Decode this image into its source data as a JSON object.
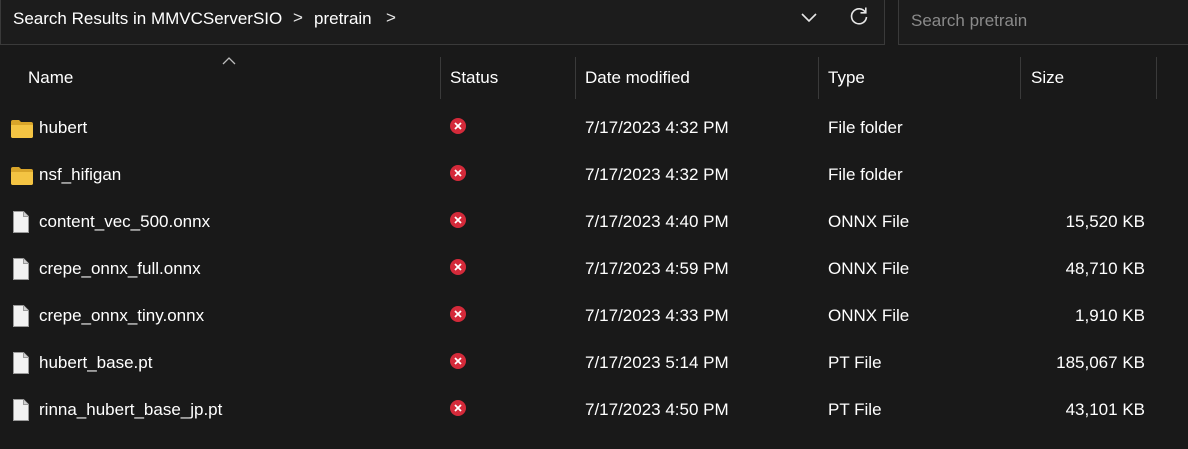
{
  "breadcrumb": {
    "items": [
      "Search Results in MMVCServerSIO",
      "pretrain"
    ],
    "separator": ">"
  },
  "search": {
    "placeholder": "Search pretrain",
    "value": ""
  },
  "columns": {
    "name": "Name",
    "status": "Status",
    "date": "Date modified",
    "type": "Type",
    "size": "Size"
  },
  "rows": [
    {
      "name": "hubert",
      "icon": "folder-icon",
      "status": "error-icon",
      "date": "7/17/2023 4:32 PM",
      "type": "File folder",
      "size": ""
    },
    {
      "name": "nsf_hifigan",
      "icon": "folder-icon",
      "status": "error-icon",
      "date": "7/17/2023 4:32 PM",
      "type": "File folder",
      "size": ""
    },
    {
      "name": "content_vec_500.onnx",
      "icon": "file-icon",
      "status": "error-icon",
      "date": "7/17/2023 4:40 PM",
      "type": "ONNX File",
      "size": "15,520 KB"
    },
    {
      "name": "crepe_onnx_full.onnx",
      "icon": "file-icon",
      "status": "error-icon",
      "date": "7/17/2023 4:59 PM",
      "type": "ONNX File",
      "size": "48,710 KB"
    },
    {
      "name": "crepe_onnx_tiny.onnx",
      "icon": "file-icon",
      "status": "error-icon",
      "date": "7/17/2023 4:33 PM",
      "type": "ONNX File",
      "size": "1,910 KB"
    },
    {
      "name": "hubert_base.pt",
      "icon": "file-icon",
      "status": "error-icon",
      "date": "7/17/2023 5:14 PM",
      "type": "PT File",
      "size": "185,067 KB"
    },
    {
      "name": "rinna_hubert_base_jp.pt",
      "icon": "file-icon",
      "status": "error-icon",
      "date": "7/17/2023 4:50 PM",
      "type": "PT File",
      "size": "43,101 KB"
    }
  ],
  "colors": {
    "background": "#191919",
    "status_error": "#d42a3a",
    "folder": "#f4c443"
  }
}
